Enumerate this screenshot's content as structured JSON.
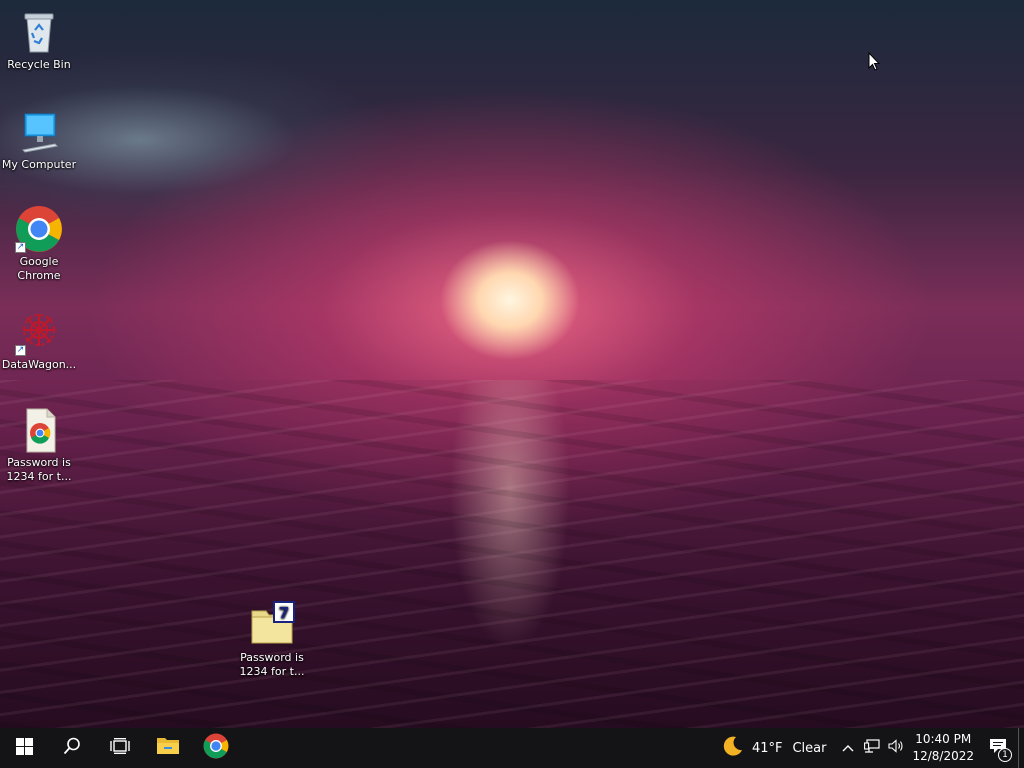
{
  "desktop": {
    "icons": [
      {
        "label": "Recycle Bin",
        "icon": "recycle-bin-icon"
      },
      {
        "label": "My Computer",
        "icon": "computer-icon"
      },
      {
        "label": "Google Chrome",
        "icon": "chrome-icon"
      },
      {
        "label": "DataWagon...",
        "icon": "datawagon-icon"
      },
      {
        "label": "Password is 1234 for t...",
        "icon": "chrome-html-file-icon"
      },
      {
        "label": "Password is 1234 for t...",
        "icon": "7zip-archive-icon"
      }
    ]
  },
  "taskbar": {
    "pinned": [
      {
        "name": "start",
        "icon": "windows-logo-icon"
      },
      {
        "name": "search",
        "icon": "search-icon"
      },
      {
        "name": "task-view",
        "icon": "task-view-icon"
      },
      {
        "name": "file-explorer",
        "icon": "folder-icon"
      },
      {
        "name": "chrome",
        "icon": "chrome-icon"
      }
    ],
    "weather": {
      "temp": "41°F",
      "condition": "Clear",
      "icon": "moon-icon"
    },
    "clock": {
      "time": "10:40 PM",
      "date": "12/8/2022"
    },
    "notifications": {
      "count": "1"
    }
  },
  "colors": {
    "taskbar": "#141416",
    "chrome_red": "#db4437",
    "chrome_green": "#0f9d58",
    "chrome_yellow": "#f4b400",
    "chrome_blue": "#4285f4"
  }
}
